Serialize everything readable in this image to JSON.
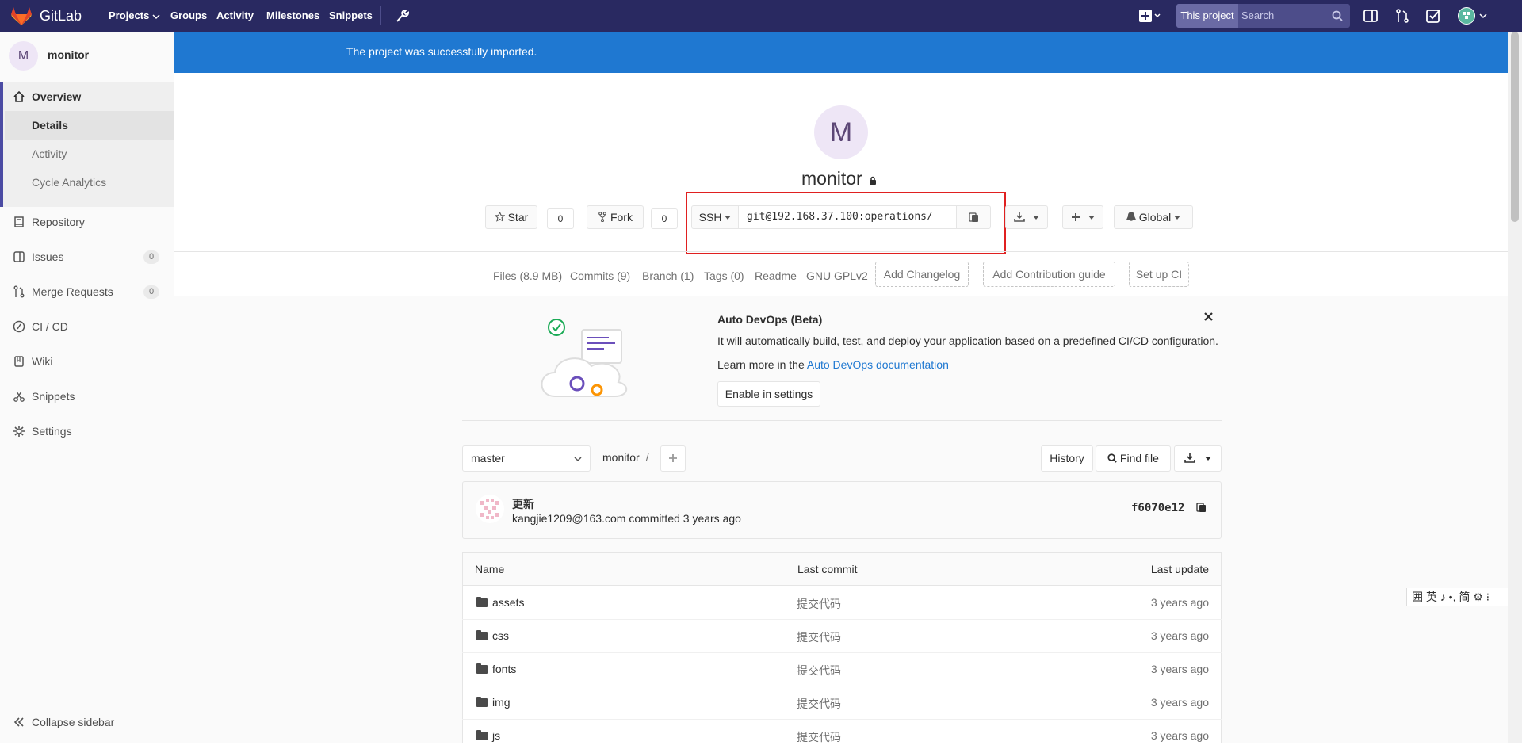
{
  "navbar": {
    "brand": "GitLab",
    "links": [
      "Projects",
      "Groups",
      "Activity",
      "Milestones",
      "Snippets"
    ],
    "search_scope": "This project",
    "search_placeholder": "Search",
    "brand_color": "#292961"
  },
  "sidebar": {
    "project_initial": "M",
    "project_name": "monitor",
    "overview": "Overview",
    "sub_items": [
      "Details",
      "Activity",
      "Cycle Analytics"
    ],
    "items": [
      {
        "label": "Repository",
        "icon": "repository-icon"
      },
      {
        "label": "Issues",
        "icon": "issues-icon",
        "count": "0"
      },
      {
        "label": "Merge Requests",
        "icon": "merge-request-icon",
        "count": "0"
      },
      {
        "label": "CI / CD",
        "icon": "rocket-icon"
      },
      {
        "label": "Wiki",
        "icon": "book-icon"
      },
      {
        "label": "Snippets",
        "icon": "scissors-icon"
      },
      {
        "label": "Settings",
        "icon": "gear-icon"
      }
    ],
    "collapse": "Collapse sidebar"
  },
  "flash": {
    "message": "The project was successfully imported.",
    "color": "#1f78d1"
  },
  "project": {
    "initial": "M",
    "name": "monitor",
    "star_label": "Star",
    "star_count": "0",
    "fork_label": "Fork",
    "fork_count": "0",
    "clone_protocol": "SSH",
    "clone_url": "git@192.168.37.100:operations/",
    "notification": "Global"
  },
  "stats": {
    "files": "Files (8.9 MB)",
    "commits": "Commits (9)",
    "branch": "Branch (1)",
    "tags": "Tags (0)",
    "readme": "Readme",
    "license": "GNU GPLv2",
    "add_changelog": "Add Changelog",
    "add_contribution": "Add Contribution guide",
    "setup_ci": "Set up CI"
  },
  "autodevops": {
    "title": "Auto DevOps (Beta)",
    "description": "It will automatically build, test, and deploy your application based on a predefined CI/CD configuration.",
    "learn_prefix": "Learn more in the ",
    "learn_link": "Auto DevOps documentation",
    "enable_button": "Enable in settings"
  },
  "repo": {
    "branch": "master",
    "path": "monitor",
    "path_sep": "/",
    "history": "History",
    "find_file": "Find file"
  },
  "commit": {
    "title": "更新",
    "author": "kangjie1209@163.com",
    "meta": "committed 3 years ago",
    "sha": "f6070e12"
  },
  "file_table": {
    "headers": [
      "Name",
      "Last commit",
      "Last update"
    ],
    "rows": [
      {
        "name": "assets",
        "commit": "提交代码",
        "updated": "3 years ago"
      },
      {
        "name": "css",
        "commit": "提交代码",
        "updated": "3 years ago"
      },
      {
        "name": "fonts",
        "commit": "提交代码",
        "updated": "3 years ago"
      },
      {
        "name": "img",
        "commit": "提交代码",
        "updated": "3 years ago"
      },
      {
        "name": "js",
        "commit": "提交代码",
        "updated": "3 years ago"
      }
    ]
  },
  "ime_bar": "囲 英 ♪ •, 简 ⚙ ⁝",
  "highlight_color": "#e02020"
}
